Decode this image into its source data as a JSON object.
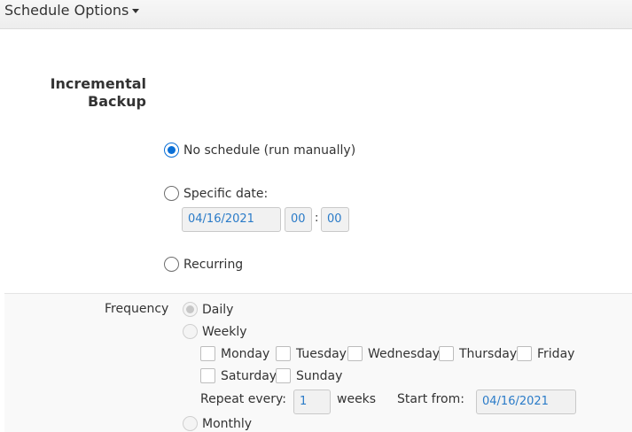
{
  "menu": {
    "label": "Schedule Options"
  },
  "section": {
    "title_line1": "Incremental",
    "title_line2": "Backup"
  },
  "schedule": {
    "no_schedule": "No schedule (run manually)",
    "specific_date": "Specific date:",
    "date_value": "04/16/2021",
    "hour_value": "00",
    "minute_value": "00",
    "time_sep": ":",
    "recurring": "Recurring"
  },
  "frequency": {
    "label": "Frequency",
    "daily": "Daily",
    "weekly": "Weekly",
    "monthly": "Monthly",
    "days": [
      "Monday",
      "Tuesday",
      "Wednesday",
      "Thursday",
      "Friday",
      "Saturday",
      "Sunday"
    ],
    "repeat_every_label": "Repeat every:",
    "repeat_value": "1",
    "weeks_label": "weeks",
    "start_from_label": "Start from:",
    "start_date_value": "04/16/2021"
  },
  "colors": {
    "accent": "#0a6fd6",
    "field_text": "#2a7bc8"
  }
}
